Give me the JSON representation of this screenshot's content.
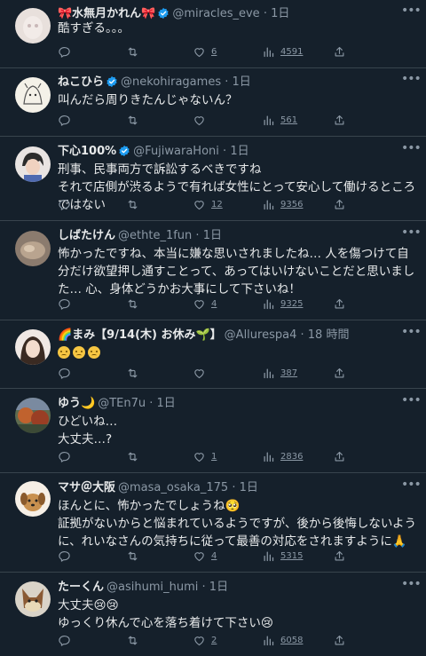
{
  "tweets": [
    {
      "name": "🎀水無月かれん🎀",
      "verified": true,
      "handle": "@miracles_eve",
      "time": "1日",
      "text": "酷すぎる。。。",
      "stats": {
        "replies": "",
        "retweets": "",
        "likes": "6",
        "views": "4591"
      }
    },
    {
      "name": "ねこひら",
      "verified": true,
      "handle": "@nekohiragames",
      "time": "1日",
      "text": "叫んだら周りきたんじゃないん？",
      "stats": {
        "replies": "",
        "retweets": "",
        "likes": "",
        "views": "561"
      }
    },
    {
      "name": "下心100%",
      "verified": true,
      "handle": "@FujiwaraHoni",
      "time": "1日",
      "text": "刑事、民事両方で訴訟するべきですね\nそれで店側が渋るようで有れば女性にとって安心して働けるところではない",
      "stats": {
        "replies": "",
        "retweets": "",
        "likes": "12",
        "views": "9356"
      }
    },
    {
      "name": "しばたけん",
      "verified": false,
      "handle": "@ethte_1fun",
      "time": "1日",
      "text": "怖かったですね、本当に嫌な思いされましたね… 人を傷つけて自分だけ欲望押し通すことって、あってはいけないことだと思いました… 心、身体どうかお大事にして下さいね！",
      "stats": {
        "replies": "",
        "retweets": "",
        "likes": "4",
        "views": "9325"
      }
    },
    {
      "name": "🌈まみ【9/14(木) お休み🌱】",
      "verified": false,
      "handle": "@Allurespa4",
      "time": "18 時間",
      "text": "",
      "emoji_count": 3,
      "stats": {
        "replies": "",
        "retweets": "",
        "likes": "",
        "views": "387"
      }
    },
    {
      "name": "ゆう🌙",
      "verified": false,
      "handle": "@TEn7u",
      "time": "1日",
      "text": "ひどいね…\n大丈夫…?",
      "stats": {
        "replies": "",
        "retweets": "",
        "likes": "1",
        "views": "2836"
      }
    },
    {
      "name": "マサ＠大阪",
      "verified": false,
      "handle": "@masa_osaka_175",
      "time": "1日",
      "text": "ほんとに、怖かったでしょうね🥺\n証拠がないからと悩まれているようですが、後から後悔しないように、れいなさんの気持ちに従って最善の対応をされますように🙏",
      "stats": {
        "replies": "",
        "retweets": "",
        "likes": "4",
        "views": "5315"
      }
    },
    {
      "name": "たーくん",
      "verified": false,
      "handle": "@asihumi_humi",
      "time": "1日",
      "text": "大丈夫😢😢\nゆっくり休んで心を落ち着けて下さい😢",
      "stats": {
        "replies": "",
        "retweets": "",
        "likes": "2",
        "views": "6058"
      }
    }
  ],
  "separator": "·",
  "colors": {
    "background": "#15202b",
    "divider": "#38444d",
    "muted": "#8b98a5",
    "text": "#e7e9ea",
    "verified": "#1d9bf0"
  }
}
